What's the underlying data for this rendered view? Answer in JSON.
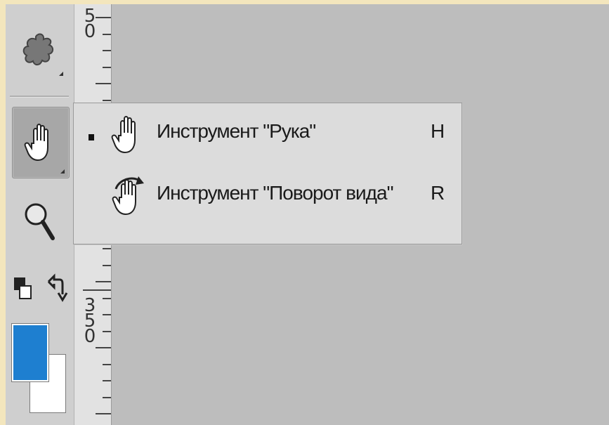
{
  "toolbar": {
    "tools": [
      {
        "name": "puppet-warp-tool",
        "icon": "puppet-icon"
      },
      {
        "name": "hand-tool",
        "icon": "hand-icon",
        "active": true
      },
      {
        "name": "zoom-tool",
        "icon": "magnifier-icon"
      },
      {
        "name": "default-colors",
        "icon": "default-colors-icon"
      },
      {
        "name": "swap-colors",
        "icon": "swap-arrow-icon"
      }
    ],
    "foreground_color": "#1e7fd0",
    "background_color": "#ffffff"
  },
  "ruler": {
    "labels": [
      "5",
      "0",
      "3",
      "5",
      "0"
    ]
  },
  "flyout": {
    "items": [
      {
        "label": "Инструмент \"Рука\"",
        "shortcut": "H",
        "selected": true,
        "icon": "hand-icon"
      },
      {
        "label": "Инструмент \"Поворот вида\"",
        "shortcut": "R",
        "selected": false,
        "icon": "rotate-view-icon"
      }
    ]
  }
}
